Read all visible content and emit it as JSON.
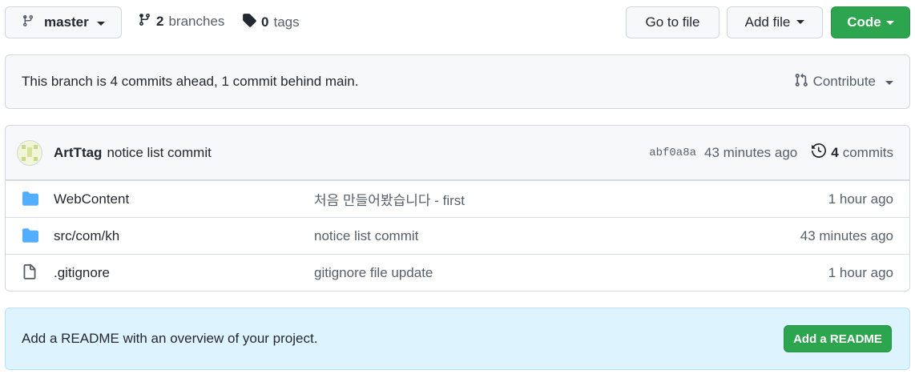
{
  "branch_selector": {
    "label": "master",
    "icon": "git-branch-icon"
  },
  "branches": {
    "count": "2",
    "label": "branches",
    "icon": "git-branch-icon"
  },
  "tags": {
    "count": "0",
    "label": "tags",
    "icon": "tag-icon"
  },
  "toolbar": {
    "goto_file": "Go to file",
    "add_file": "Add file",
    "code": "Code"
  },
  "branch_info": {
    "message": "This branch is 4 commits ahead, 1 commit behind main.",
    "contribute": "Contribute"
  },
  "latest_commit": {
    "author": "ArtTtag",
    "message": "notice list commit",
    "sha": "abf0a8a",
    "time": "43 minutes ago",
    "count": "4",
    "count_label": "commits"
  },
  "files": [
    {
      "name": "WebContent",
      "type": "folder",
      "commit_message": "처음 만들어봤습니다 - first",
      "age": "1 hour ago"
    },
    {
      "name": "src/com/kh",
      "type": "folder",
      "commit_message": "notice list commit",
      "age": "43 minutes ago"
    },
    {
      "name": ".gitignore",
      "type": "file",
      "commit_message": "gitignore file update",
      "age": "1 hour ago"
    }
  ],
  "readme": {
    "message": "Add a README with an overview of your project.",
    "button": "Add a README"
  },
  "colors": {
    "primary_green": "#2da44e",
    "folder_blue": "#54aeff",
    "readme_bg": "#ddf4ff"
  }
}
